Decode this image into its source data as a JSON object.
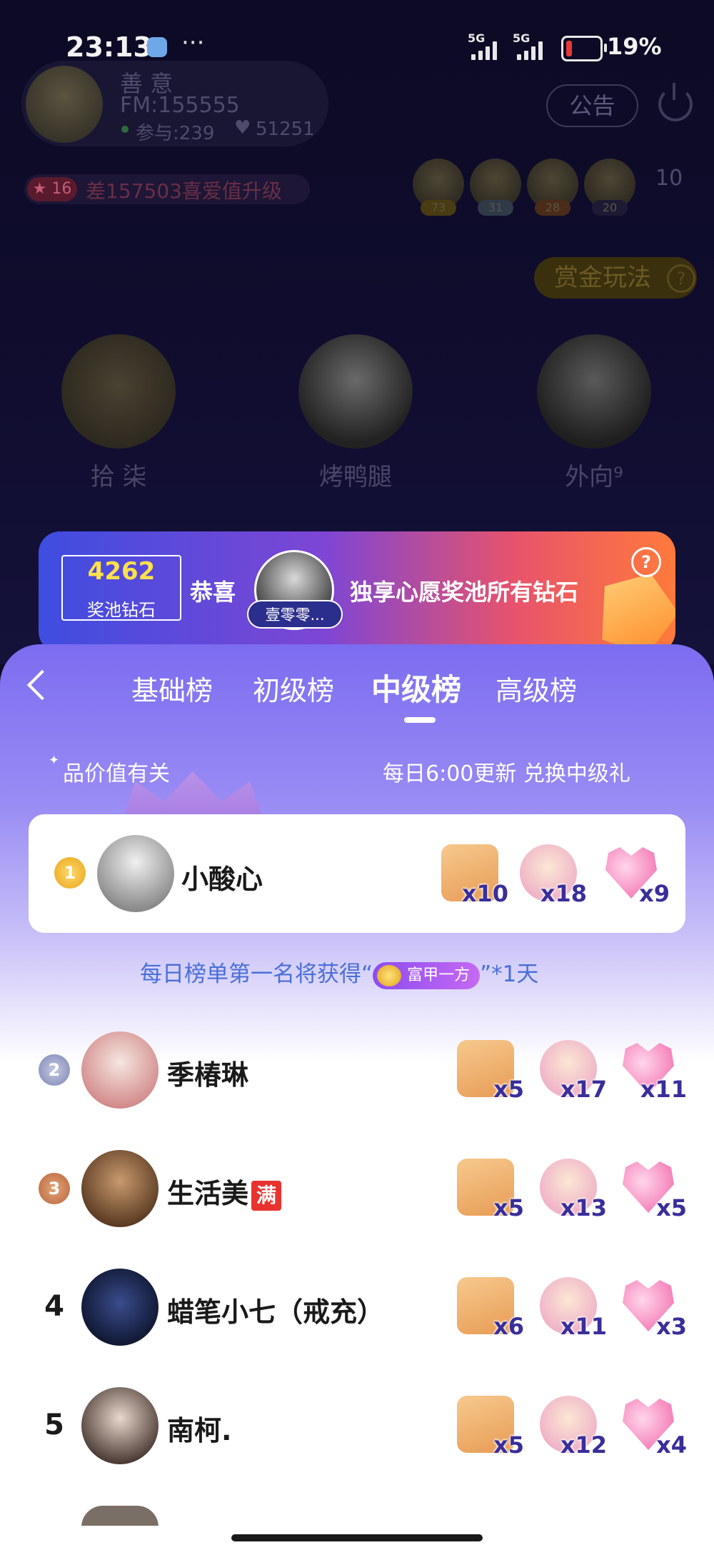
{
  "status_bar": {
    "time": "23:13",
    "more": "···",
    "network_1": "5G",
    "network_2": "5G",
    "battery_pct": "19%",
    "battery_level": 0.19
  },
  "room": {
    "host_name": "善 意",
    "room_fm": "FM:155555",
    "participants": "参与:239",
    "hearts": "51251",
    "notice_label": "公告",
    "level_badge": "16",
    "upgrade_hint": "差157503喜爱值升级",
    "top_fans": [
      "73",
      "31",
      "28",
      "20"
    ],
    "online_count": "10",
    "bounty_label": "赏金玩法",
    "bounty_help": "?",
    "seats": [
      {
        "name": "拾 柒"
      },
      {
        "name": "烤鸭腿"
      },
      {
        "name": "外向⁹"
      }
    ]
  },
  "banner": {
    "pool_value": "4262",
    "pool_label": "奖池钻石",
    "congrats": "恭喜",
    "winner_name": "壹零零...",
    "message": "独享心愿奖池所有钻石",
    "help": "?"
  },
  "ranking": {
    "tabs": [
      {
        "label": "基础榜"
      },
      {
        "label": "初级榜"
      },
      {
        "label": "中级榜",
        "active": true
      },
      {
        "label": "高级榜"
      }
    ],
    "marquee_left": "品价值有关",
    "marquee_right": "每日6:00更新 兑换中级礼",
    "daily_note_prefix": "每日榜单第一名将获得“",
    "daily_badge": "富甲一方",
    "daily_note_suffix": "”*1天",
    "entries": [
      {
        "rank": "1",
        "name": "小酸心",
        "full_tag": "",
        "gifts": [
          "x10",
          "x18",
          "x9"
        ]
      },
      {
        "rank": "2",
        "name": "季椿琳",
        "full_tag": "",
        "gifts": [
          "x5",
          "x17",
          "x11"
        ]
      },
      {
        "rank": "3",
        "name": "生活美",
        "full_tag": "满",
        "gifts": [
          "x5",
          "x13",
          "x5"
        ]
      },
      {
        "rank": "4",
        "name": "蜡笔小七（戒充）",
        "full_tag": "",
        "gifts": [
          "x6",
          "x11",
          "x3"
        ]
      },
      {
        "rank": "5",
        "name": "南柯.",
        "full_tag": "",
        "gifts": [
          "x5",
          "x12",
          "x4"
        ]
      }
    ]
  },
  "colors": {
    "accent": "#7c6cf0",
    "gold": "#ffe14a",
    "note_blue": "#4a6fd8"
  }
}
